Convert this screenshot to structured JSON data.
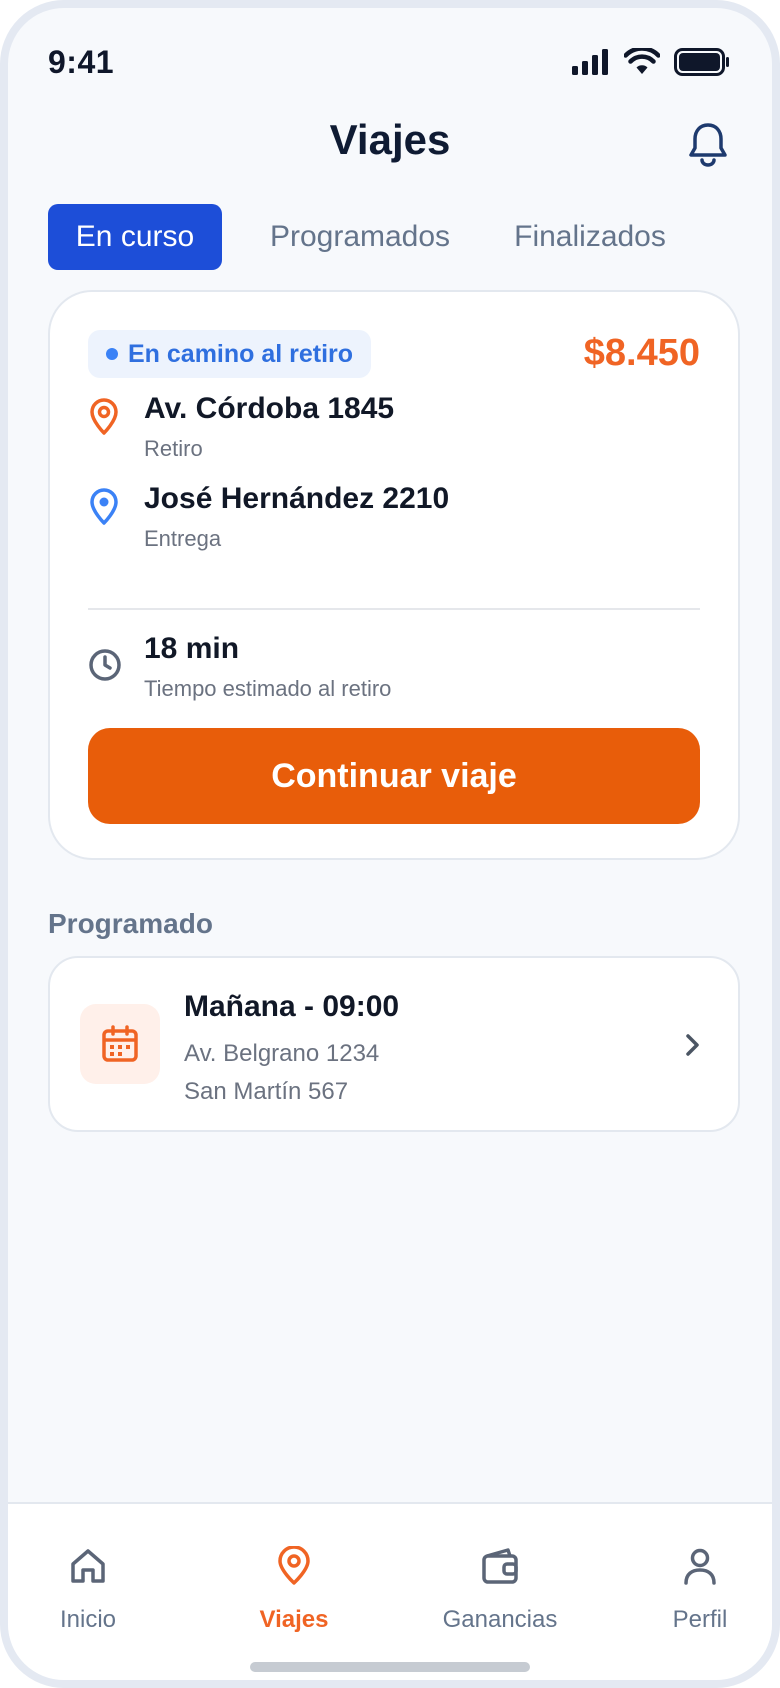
{
  "status_bar": {
    "time": "9:41"
  },
  "header": {
    "title": "Viajes"
  },
  "tabs": [
    {
      "label": "En curso",
      "active": true
    },
    {
      "label": "Programados",
      "active": false
    },
    {
      "label": "Finalizados",
      "active": false
    }
  ],
  "current_trip": {
    "status": "En camino al retiro",
    "price": "$8.450",
    "pickup": {
      "address": "Av. Córdoba 1845",
      "label": "Retiro"
    },
    "dropoff": {
      "address": "José Hernández 2210",
      "label": "Entrega"
    },
    "eta": {
      "value": "18 min",
      "label": "Tiempo estimado al retiro"
    },
    "action_label": "Continuar viaje"
  },
  "scheduled": {
    "section_title": "Programado",
    "time": "Mañana - 09:00",
    "pickup": "Av. Belgrano 1234",
    "dropoff": "San Martín 567"
  },
  "bottom_nav": [
    {
      "label": "Inicio",
      "icon": "home-icon",
      "active": false
    },
    {
      "label": "Viajes",
      "icon": "map-pin-icon",
      "active": true
    },
    {
      "label": "Ganancias",
      "icon": "wallet-icon",
      "active": false
    },
    {
      "label": "Perfil",
      "icon": "user-icon",
      "active": false
    }
  ],
  "colors": {
    "primary_blue": "#1d4ed8",
    "accent_orange": "#e85d0a",
    "price_orange": "#f06424",
    "status_blue": "#3b82f6",
    "background": "#f7f9fc"
  }
}
